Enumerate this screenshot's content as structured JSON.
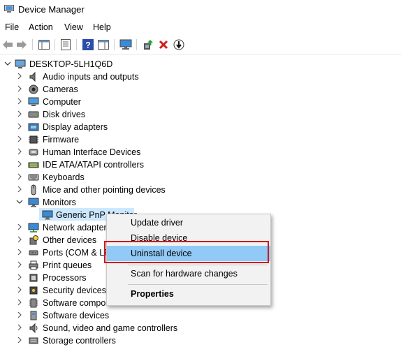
{
  "window": {
    "title": "Device Manager"
  },
  "menu": [
    "File",
    "Action",
    "View",
    "Help"
  ],
  "toolbar_icons": [
    "back-arrow-icon",
    "forward-arrow-icon",
    "show-hide-console-tree-icon",
    "properties-icon",
    "help-icon",
    "action-pane-icon",
    "scan-monitor-icon",
    "update-driver-icon",
    "uninstall-x-icon",
    "disable-device-icon"
  ],
  "tree": {
    "root": "DESKTOP-5LH1Q6D",
    "categories": [
      {
        "label": "Audio inputs and outputs",
        "icon": "speaker-icon"
      },
      {
        "label": "Cameras",
        "icon": "camera-icon"
      },
      {
        "label": "Computer",
        "icon": "computer-icon"
      },
      {
        "label": "Disk drives",
        "icon": "disk-drive-icon"
      },
      {
        "label": "Display adapters",
        "icon": "display-adapter-icon"
      },
      {
        "label": "Firmware",
        "icon": "firmware-chip-icon"
      },
      {
        "label": "Human Interface Devices",
        "icon": "hid-icon"
      },
      {
        "label": "IDE ATA/ATAPI controllers",
        "icon": "ide-controller-icon"
      },
      {
        "label": "Keyboards",
        "icon": "keyboard-icon"
      },
      {
        "label": "Mice and other pointing devices",
        "icon": "mouse-icon"
      },
      {
        "label": "Monitors",
        "icon": "monitor-icon",
        "expanded": true
      },
      {
        "label": "Network adapters",
        "icon": "network-adapter-icon"
      },
      {
        "label": "Other devices",
        "icon": "other-devices-icon"
      },
      {
        "label": "Ports (COM & LPT)",
        "icon": "port-icon"
      },
      {
        "label": "Print queues",
        "icon": "printer-icon"
      },
      {
        "label": "Processors",
        "icon": "processor-icon"
      },
      {
        "label": "Security devices",
        "icon": "security-device-icon"
      },
      {
        "label": "Software components",
        "icon": "software-component-icon"
      },
      {
        "label": "Software devices",
        "icon": "software-device-icon"
      },
      {
        "label": "Sound, video and game controllers",
        "icon": "sound-controller-icon"
      },
      {
        "label": "Storage controllers",
        "icon": "storage-controller-icon"
      }
    ],
    "monitor_child": "Generic PnP Monitor"
  },
  "context_menu": {
    "items": [
      "Update driver",
      "Disable device",
      "Uninstall device",
      "Scan for hardware changes",
      "Properties"
    ],
    "highlighted": "Uninstall device"
  },
  "colors": {
    "selection": "#cce8ff",
    "menu_highlight": "#91c9f7",
    "annotation_box": "#d0161b"
  }
}
